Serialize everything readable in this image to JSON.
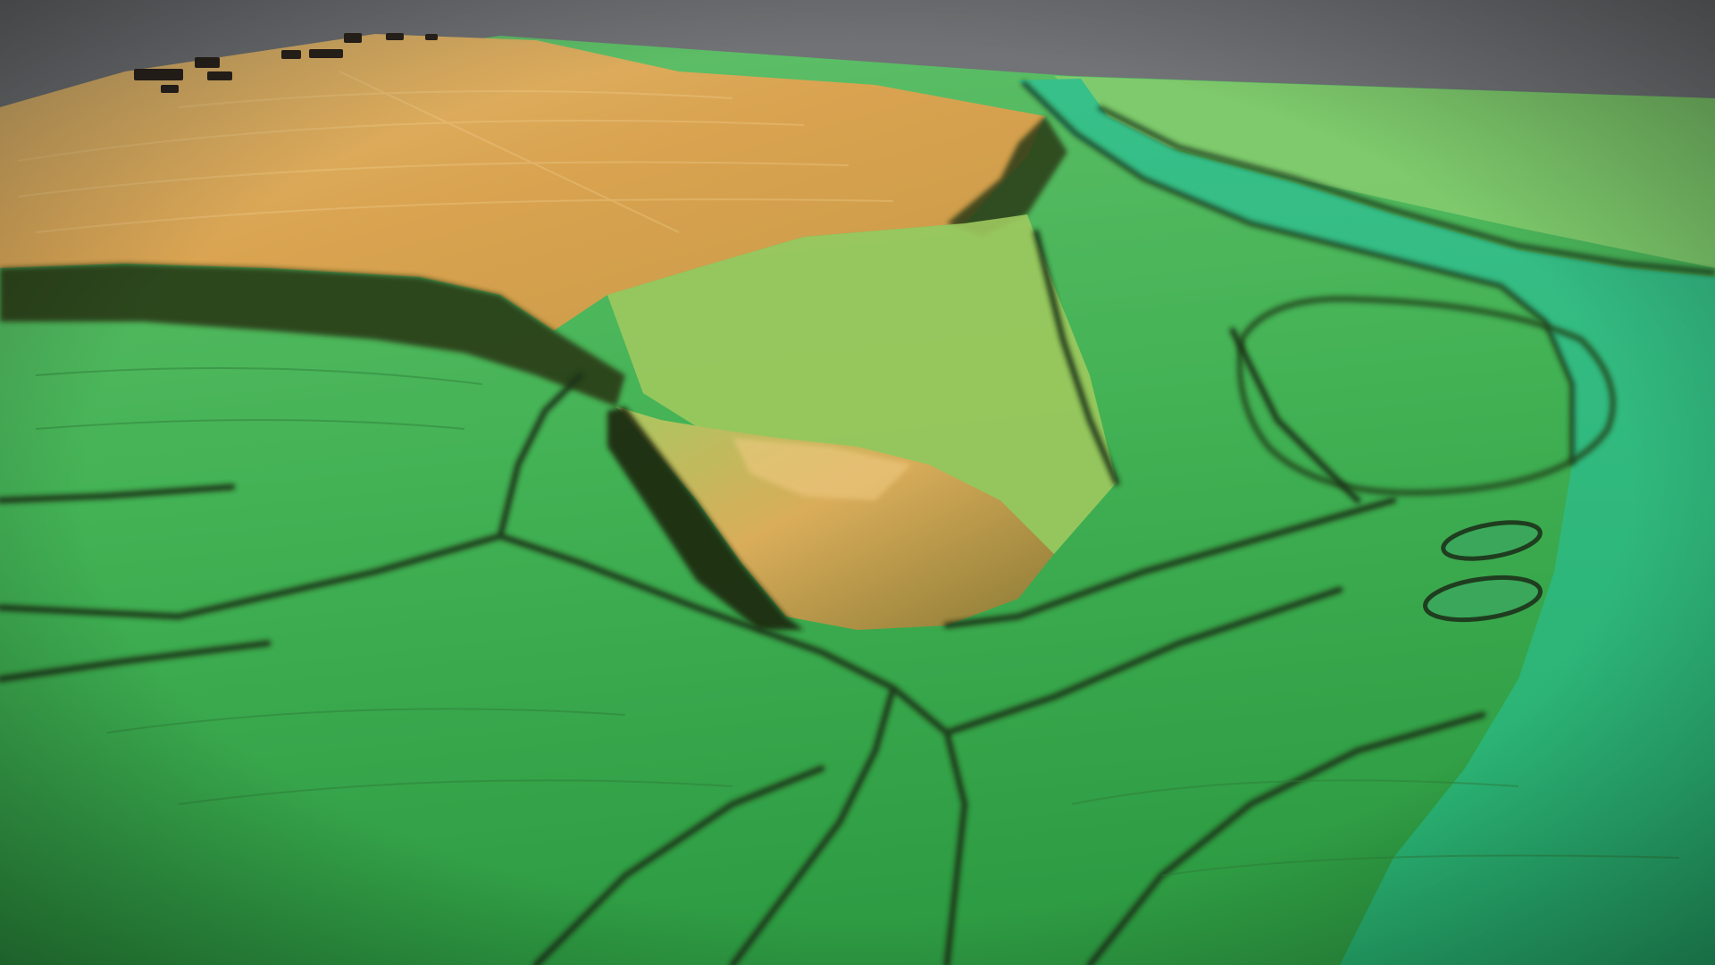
{
  "scene": {
    "kind": "lidar-elevation-model",
    "view": "oblique-3d",
    "colors": {
      "sky": "#7a7c7f",
      "lowland_green": "#3fae4e",
      "mid_green": "#7cc35a",
      "plateau_orange": "#d9a24f",
      "plateau_light": "#e6bf78",
      "escarpment_shadow": "#1f2a12",
      "river_teal": "#2fb880"
    },
    "features": [
      "upper-plateau",
      "northern-escarpment",
      "central-promontory",
      "river-channel",
      "palaeochannel-loop",
      "field-boundaries",
      "oxbow-hollows",
      "farm-buildings"
    ]
  }
}
